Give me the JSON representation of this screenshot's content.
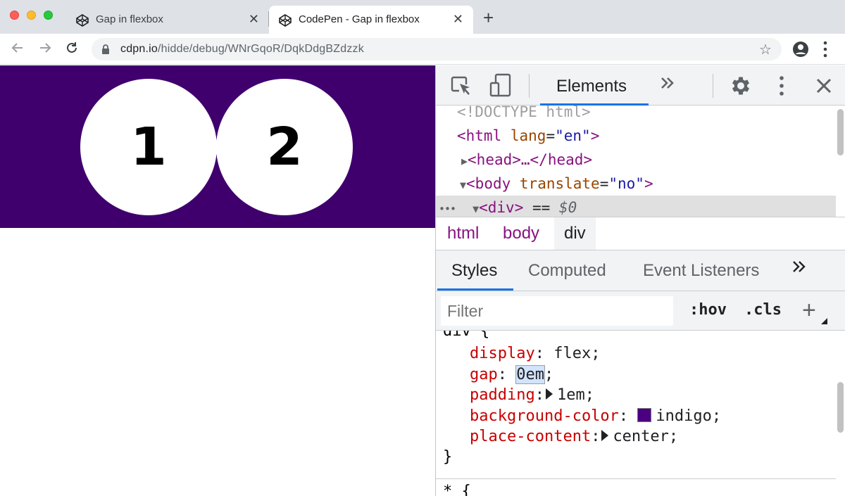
{
  "browser": {
    "tabs": [
      {
        "title": "Gap in flexbox",
        "active": false
      },
      {
        "title": "CodePen - Gap in flexbox",
        "active": true
      }
    ],
    "tab_close": "✕",
    "new_tab": "+",
    "url_host": "cdpn.io",
    "url_path": "/hidde/debug/WNrGqoR/DqkDdgBZdzzk"
  },
  "page": {
    "circles": [
      "1",
      "2"
    ],
    "background_color": "#3f006d"
  },
  "devtools": {
    "main_tab": "Elements",
    "more_tabs": "»",
    "dom": {
      "doctype": "<!DOCTYPE html>",
      "html_open_tag": "<html",
      "html_attr": "lang",
      "html_attr_value": "\"en\"",
      "html_close": ">",
      "head_collapsed": "<head>…</head>",
      "body_open_tag": "<body",
      "body_attr": "translate",
      "body_attr_value": "\"no\"",
      "body_close": ">",
      "div_tag": "<div>",
      "div_marker": " == ",
      "div_ref": "$0",
      "ellipsis": "•••"
    },
    "breadcrumbs": [
      "html",
      "body",
      "div"
    ],
    "subtabs": [
      "Styles",
      "Computed",
      "Event Listeners"
    ],
    "subtabs_more": "»",
    "filter_placeholder": "Filter",
    "hov_label": ":hov",
    "cls_label": ".cls",
    "add_rule": "+",
    "css_rule": {
      "selector": "div {",
      "declarations": [
        {
          "property": "display",
          "value": "flex;"
        },
        {
          "property": "gap",
          "value": "0em"
        },
        {
          "property": "padding",
          "value": "1em;"
        },
        {
          "property": "background-color",
          "value": "indigo;"
        },
        {
          "property": "place-content",
          "value": "center;"
        }
      ],
      "close": "}",
      "next_selector": "* {"
    },
    "swatch_color": "#4b0082"
  }
}
